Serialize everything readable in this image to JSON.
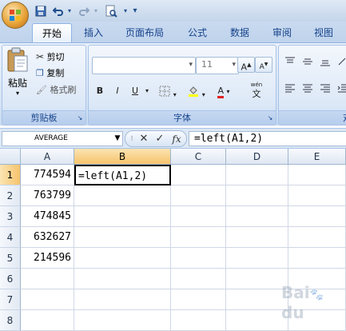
{
  "quick_access": {
    "save_icon": "save-icon",
    "undo_icon": "undo-icon",
    "redo_icon": "redo-icon",
    "print_preview_icon": "print-preview-icon",
    "customize_icon": "customize-dropdown-icon"
  },
  "tabs": [
    {
      "label": "开始",
      "active": true
    },
    {
      "label": "插入",
      "active": false
    },
    {
      "label": "页面布局",
      "active": false
    },
    {
      "label": "公式",
      "active": false
    },
    {
      "label": "数据",
      "active": false
    },
    {
      "label": "审阅",
      "active": false
    },
    {
      "label": "视图",
      "active": false
    }
  ],
  "ribbon": {
    "clipboard": {
      "paste_label": "粘贴",
      "cut_label": "剪切",
      "copy_label": "复制",
      "format_painter_label": "格式刷",
      "group_label": "剪贴板"
    },
    "font": {
      "font_name": "",
      "font_size": "11",
      "grow_label": "A",
      "shrink_label": "A",
      "bold_label": "B",
      "italic_label": "I",
      "underline_label": "U",
      "font_color_label": "A",
      "phonetic_label": "wén",
      "phonetic_char": "文",
      "group_label": "字体"
    },
    "alignment": {
      "group_label_partial": "对"
    }
  },
  "formula_bar": {
    "name_box": "AVERAGE",
    "cancel_symbol": "✕",
    "enter_symbol": "✓",
    "fx_label": "fx",
    "formula": "=left(A1,2)"
  },
  "sheet": {
    "columns": [
      "A",
      "B",
      "C",
      "D",
      "E"
    ],
    "rows": [
      "1",
      "2",
      "3",
      "4",
      "5",
      "6",
      "7",
      "8"
    ],
    "active_cell": "B1",
    "cells": {
      "A1": "774594",
      "A2": "763799",
      "A3": "474845",
      "A4": "632627",
      "A5": "214596",
      "B1": "=left(A1,2)"
    }
  },
  "watermark": "Baidu"
}
